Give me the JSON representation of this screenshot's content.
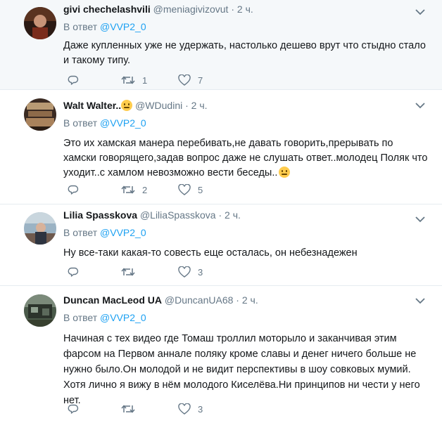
{
  "tweets": [
    {
      "name": "givi chechelashvili",
      "handle": "@meniagivizovut",
      "time": "2 ч.",
      "reply_prefix": "В ответ",
      "reply_to": "@VVP2_0",
      "text": "Даже купленных уже не удержать, настолько дешево врут что стыдно стало и такому типу.",
      "replies": "",
      "retweets": "1",
      "likes": "7"
    },
    {
      "name": "Walt Walter..",
      "handle": "@WDudini",
      "time": "2 ч.",
      "reply_prefix": "В ответ",
      "reply_to": "@VVP2_0",
      "text": "Это их хамская манера перебивать,не давать говорить,прерывать по хамски говорящего,задав вопрос даже не слушать ответ..молодец Поляк что уходит..с хамлом невозможно вести беседы..",
      "replies": "",
      "retweets": "2",
      "likes": "5"
    },
    {
      "name": "Lilia Spasskova",
      "handle": "@LiliaSpasskova",
      "time": "2 ч.",
      "reply_prefix": "В ответ",
      "reply_to": "@VVP2_0",
      "text": "Ну все-таки какая-то совесть еще осталась, он небезнадежен",
      "replies": "",
      "retweets": "",
      "likes": "3"
    },
    {
      "name": "Duncan MacLeod UA",
      "handle": "@DuncanUA68",
      "time": "2 ч.",
      "reply_prefix": "В ответ",
      "reply_to": "@VVP2_0",
      "text": "Начиная с тех видео где Томаш троллил моторыло и заканчивая этим фарсом на Первом аннале поляку кроме славы и денег ничего больше не нужно было.Он молодой и не видит перспективы в шоу совковых мумий. Хотя лично я вижу в нём молодого Киселёва.Ни принципов ни чести у него нет.",
      "replies": "",
      "retweets": "",
      "likes": "3"
    }
  ],
  "icons": {
    "reply": "reply-icon",
    "retweet": "retweet-icon",
    "like": "heart-icon",
    "menu": "chevron-down-icon",
    "emoji": "neutral-face-emoji"
  },
  "colors": {
    "link": "#1da1f2",
    "muted": "#657786",
    "text": "#14171a",
    "highlight_bg": "#f5f8fa",
    "border": "#e6ecf0"
  }
}
